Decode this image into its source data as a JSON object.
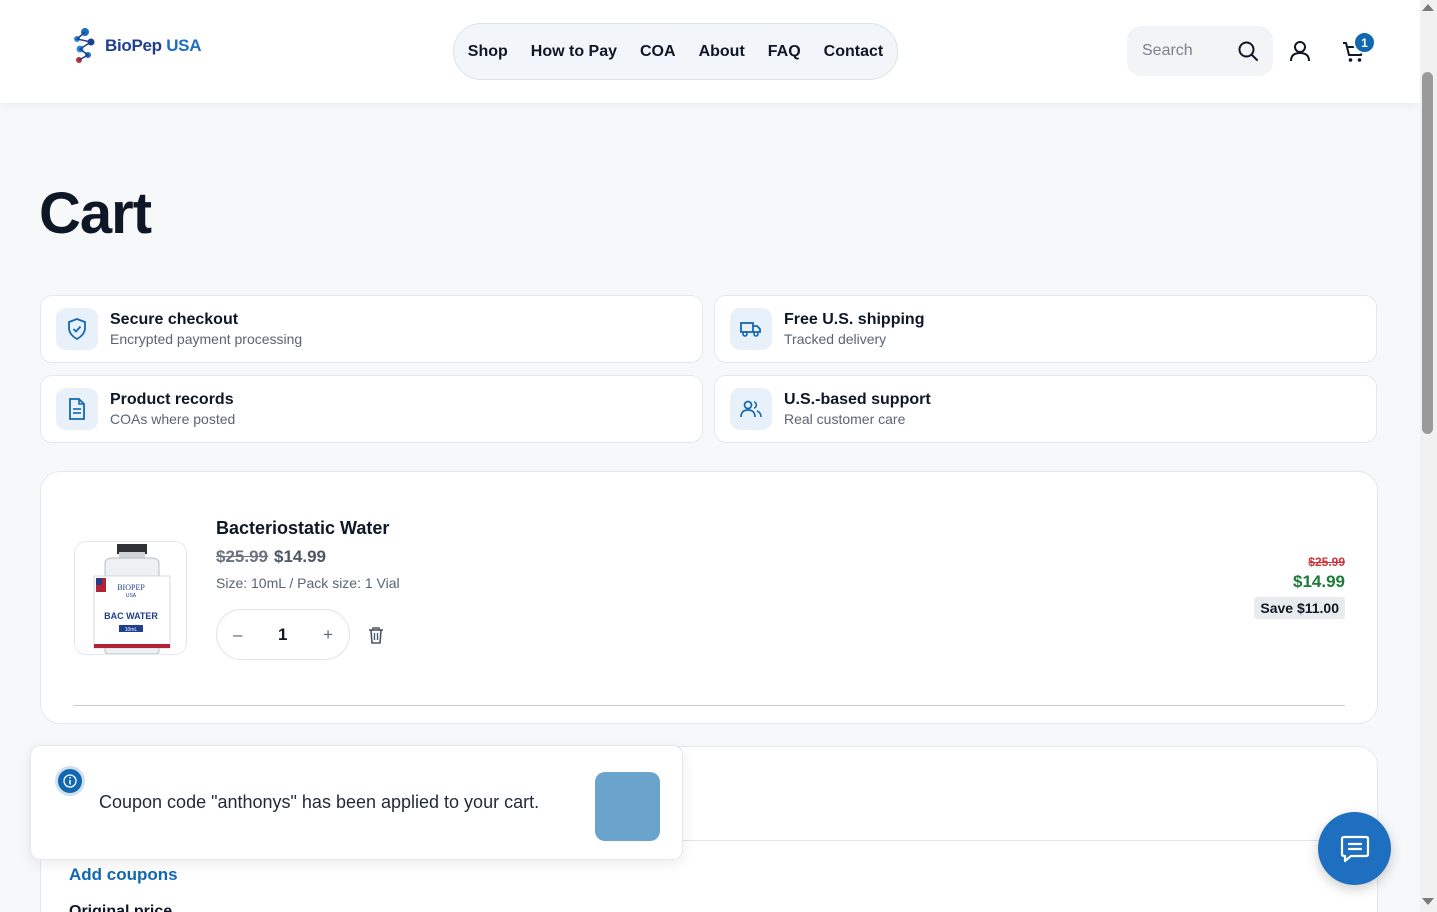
{
  "header": {
    "logo_text": "BioPep",
    "logo_suffix": "USA",
    "nav": [
      "Shop",
      "How to Pay",
      "COA",
      "About",
      "FAQ",
      "Contact"
    ],
    "search_placeholder": "Search",
    "cart_count": "1"
  },
  "page": {
    "title": "Cart"
  },
  "features": [
    {
      "title": "Secure checkout",
      "subtitle": "Encrypted payment processing",
      "icon": "shield-check-icon"
    },
    {
      "title": "Free U.S. shipping",
      "subtitle": "Tracked delivery",
      "icon": "truck-icon"
    },
    {
      "title": "Product records",
      "subtitle": "COAs where posted",
      "icon": "document-icon"
    },
    {
      "title": "U.S.-based support",
      "subtitle": "Real customer care",
      "icon": "users-icon"
    }
  ],
  "cart_item": {
    "name": "Bacteriostatic Water",
    "original_price": "$25.99",
    "price": "$14.99",
    "meta": "Size: 10mL / Pack size: 1 Vial",
    "quantity": "1",
    "decrement_label": "–",
    "increment_label": "+",
    "line_original": "$25.99",
    "line_total": "$14.99",
    "savings": "Save $11.00",
    "image_label_brand": "BIOPEP",
    "image_label_sub": "USA",
    "image_label_product": "BAC WATER",
    "image_label_size": "10mL"
  },
  "totals": {
    "add_coupons": "Add coupons",
    "original_price_label": "Original price"
  },
  "toast": {
    "message": "Coupon code \"anthonys\" has been applied to your cart."
  },
  "colors": {
    "brand": "#1268b0",
    "sale_red": "#d1323a",
    "sale_green": "#1c7a3a"
  }
}
